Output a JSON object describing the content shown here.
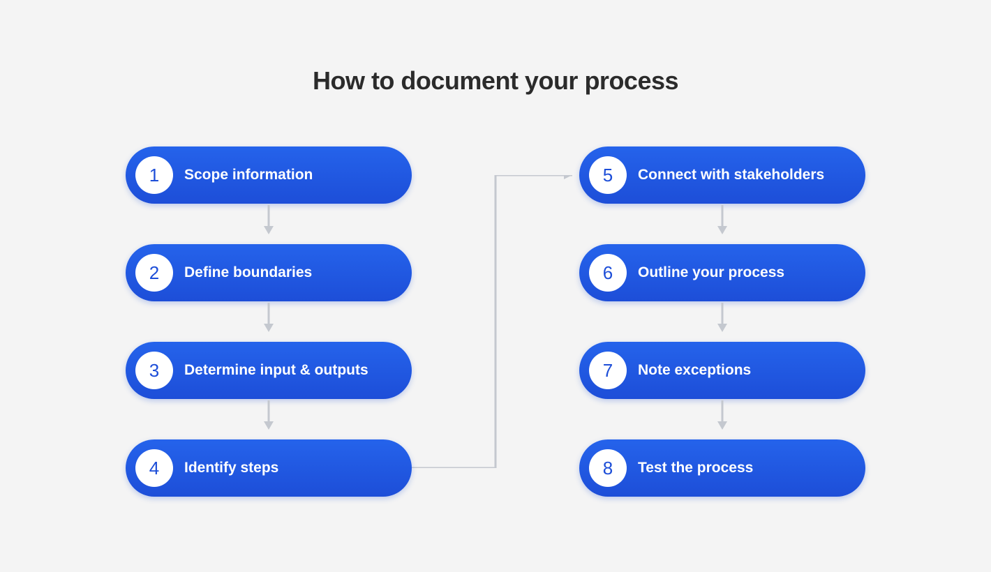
{
  "title": "How to document your process",
  "colors": {
    "pill_bg_top": "#2563eb",
    "pill_bg_bottom": "#1d4ed8",
    "badge_bg": "#ffffff",
    "badge_text": "#1d4ed8",
    "arrow": "#c4c8cf",
    "page_bg": "#f4f4f4"
  },
  "steps": [
    {
      "n": "1",
      "label": "Scope information"
    },
    {
      "n": "2",
      "label": "Define boundaries"
    },
    {
      "n": "3",
      "label": "Determine input & outputs"
    },
    {
      "n": "4",
      "label": "Identify steps"
    },
    {
      "n": "5",
      "label": "Connect with stakeholders"
    },
    {
      "n": "6",
      "label": "Outline your process"
    },
    {
      "n": "7",
      "label": "Note exceptions"
    },
    {
      "n": "8",
      "label": "Test the process"
    }
  ]
}
